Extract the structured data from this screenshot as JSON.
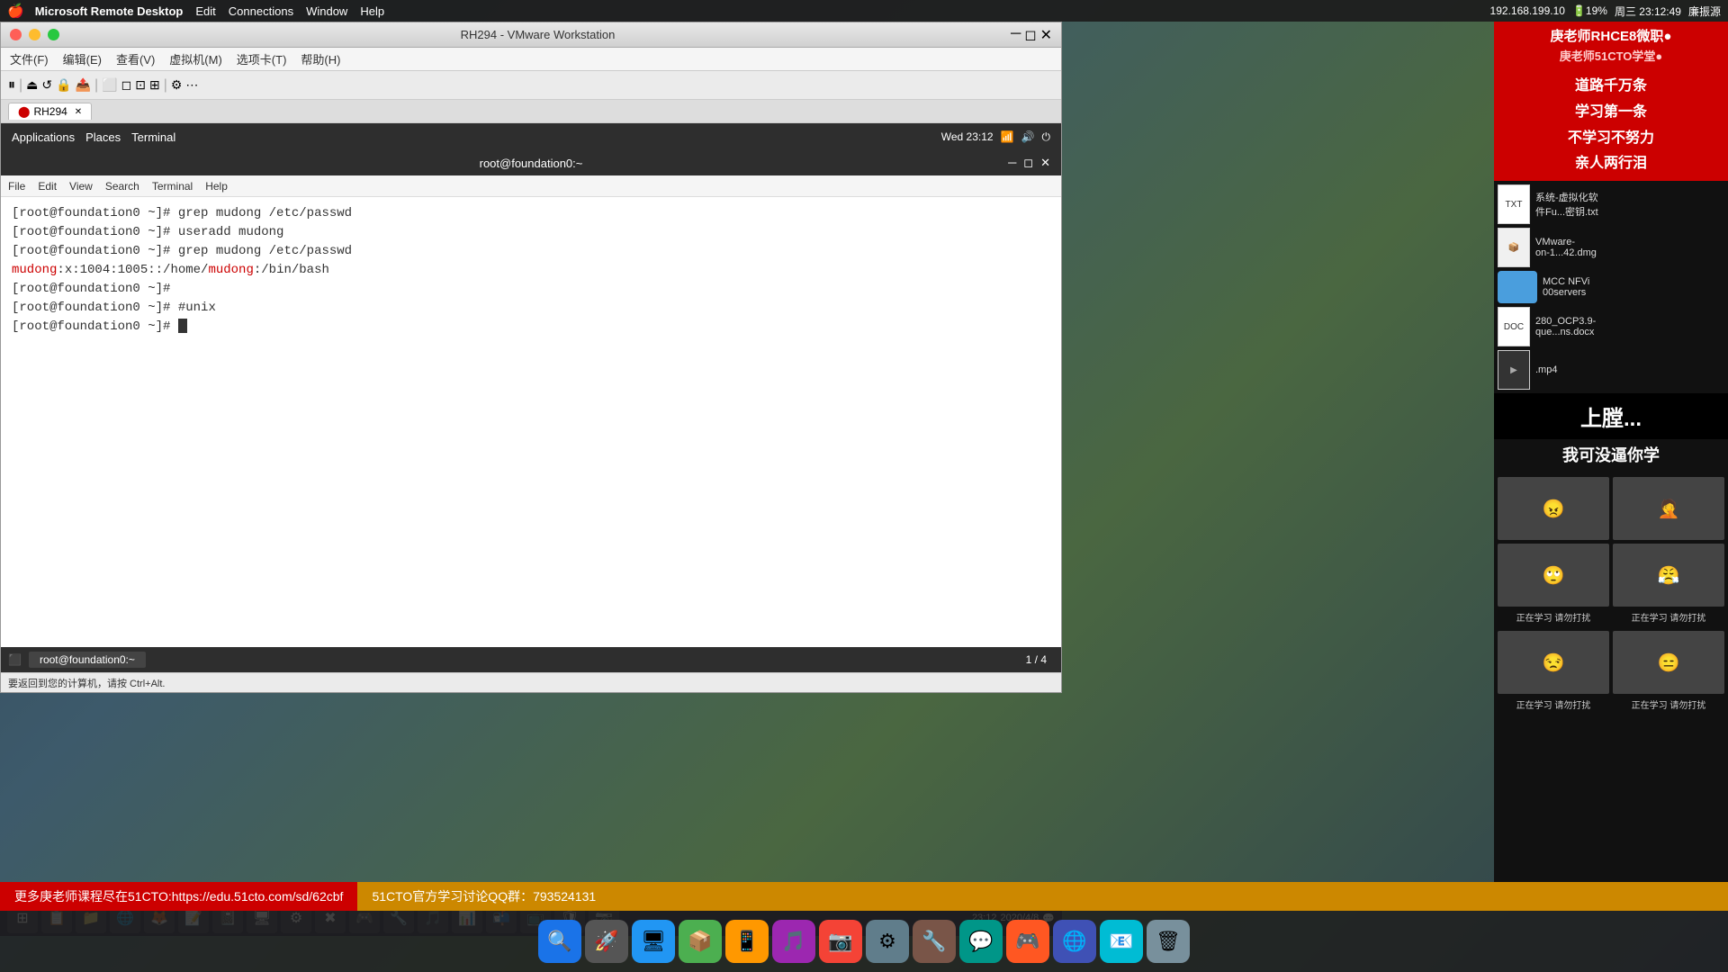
{
  "mac_menubar": {
    "apple": "🍎",
    "items": [
      "Microsoft Remote Desktop",
      "Edit",
      "Connections",
      "Window",
      "Help"
    ],
    "right": {
      "ip": "192.168.199.10",
      "battery": "19%",
      "time": "周三 23:12:49",
      "other_icons": "🔒📶🔋"
    }
  },
  "vmware": {
    "title": "RH294 - VMware Workstation",
    "menubar": [
      "文件(F)",
      "编辑(E)",
      "查看(V)",
      "虚拟机(M)",
      "选项卡(T)",
      "帮助(H)"
    ],
    "tabs": [
      {
        "label": "RH294",
        "active": true
      }
    ],
    "statusbar": "要返回到您的计算机，请按 Ctrl+Alt."
  },
  "gnome_topbar": {
    "left": [
      "Applications",
      "Places",
      "Terminal"
    ],
    "right": "Wed 23:12"
  },
  "terminal": {
    "title": "root@foundation0:~",
    "menubar": [
      "File",
      "Edit",
      "View",
      "Search",
      "Terminal",
      "Help"
    ],
    "lines": [
      {
        "prompt": "[root@foundation0 ~]# ",
        "cmd": "grep mudong /etc/passwd"
      },
      {
        "prompt": "[root@foundation0 ~]# ",
        "cmd": "useradd mudong"
      },
      {
        "prompt": "[root@foundation0 ~]# ",
        "cmd": "grep mudong /etc/passwd"
      },
      {
        "colored_line": true,
        "text": "mudong:x:1004:1005::/home/mudong:/bin/bash",
        "red_parts": [
          "mudong",
          "mudong"
        ]
      },
      {
        "prompt": "[root@foundation0 ~]# ",
        "cmd": ""
      },
      {
        "prompt": "[root@foundation0 ~]# ",
        "cmd": "#unix"
      },
      {
        "prompt": "[root@foundation0 ~]# ",
        "cmd": "",
        "cursor": true
      }
    ],
    "statusbar_tab": "root@foundation0:~",
    "page": "1 / 4"
  },
  "right_panel": {
    "header_lines": [
      "庚老师51CTO学堂●",
      "道路千万条",
      "学习第一条",
      "不学习不努力",
      "亲人两行泪"
    ],
    "panda_text": "上膛...",
    "files": [
      {
        "name": "系统-虚拟化软\n件Fu...密钥.txt",
        "type": "txt"
      },
      {
        "name": "VMware-\non-1...42.dmg",
        "type": "dmg"
      },
      {
        "name": "MCC NFVi\n00servers",
        "type": "folder"
      },
      {
        "name": "280_OCP3.9-\nque...ns.docx",
        "type": "docx"
      },
      {
        "name": ".mp4",
        "type": "mp4"
      }
    ],
    "study_label": "我可没逼你学",
    "study_caption_rows": [
      [
        "正在学习 请勿打扰",
        "正在学习 请勿打扰"
      ],
      [
        "正在学习 请勿打扰",
        "正在学习 请勿打扰"
      ]
    ]
  },
  "bottom_banner": {
    "left_text": "更多庚老师课程尽在51CTO:https://edu.51cto.com/sd/62cbf",
    "right_text": "51CTO官方学习讨论QQ群：793524131"
  },
  "win_taskbar": {
    "time": "23:12",
    "date": "2020/4/8",
    "icons": [
      "⊞",
      "📁",
      "🌐",
      "🦊",
      "📝",
      "📓",
      "🖥",
      "📋",
      "✖",
      "🎮",
      "🔧",
      "🎵",
      "📊",
      "📬"
    ]
  }
}
